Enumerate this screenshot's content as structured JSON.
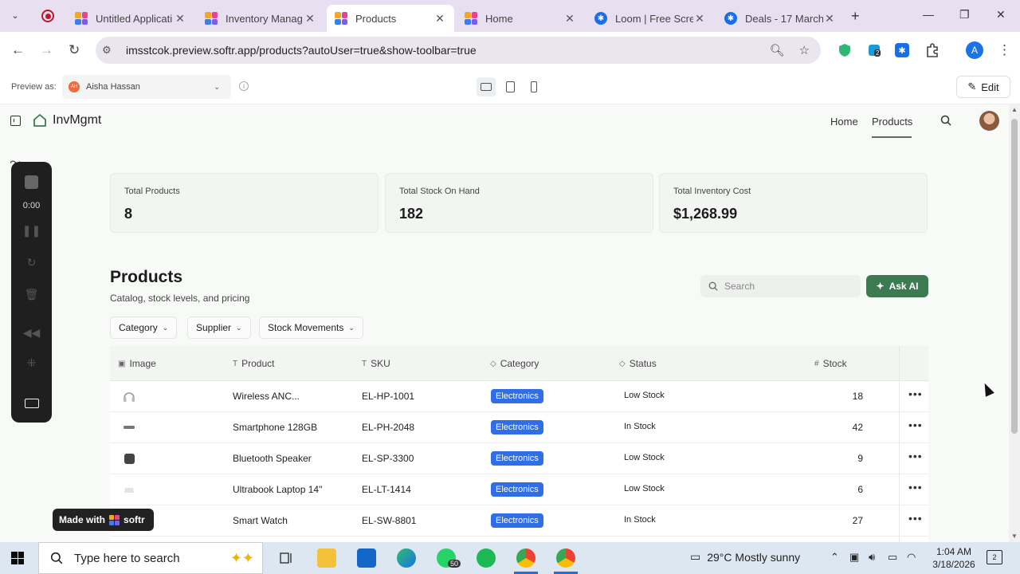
{
  "browser": {
    "tabs": [
      {
        "title": "Untitled Applicati",
        "favicon": "softr-icon"
      },
      {
        "title": "Inventory Manag",
        "favicon": "softr-icon"
      },
      {
        "title": "Products",
        "favicon": "softr-icon",
        "active": true
      },
      {
        "title": "Home",
        "favicon": "softr-icon"
      },
      {
        "title": "Loom | Free Scre",
        "favicon": "loom-icon"
      },
      {
        "title": "Deals - 17 March",
        "favicon": "loom-icon"
      }
    ],
    "url": "imsstcok.preview.softr.app/products?autoUser=true&show-toolbar=true",
    "extension_badge": "2",
    "profile_initial": "A"
  },
  "preview_bar": {
    "label": "Preview as:",
    "user_initials": "AH",
    "user_name": "Aisha Hassan",
    "edit_label": "Edit"
  },
  "app": {
    "logo_text": "InvMgmt",
    "nav": [
      {
        "label": "Home"
      },
      {
        "label": "Products",
        "active": true
      }
    ],
    "stats": [
      {
        "label": "Total Products",
        "value": "8"
      },
      {
        "label": "Total Stock On Hand",
        "value": "182"
      },
      {
        "label": "Total Inventory Cost",
        "value": "$1,268.99"
      }
    ],
    "section": {
      "title": "Products",
      "subtitle": "Catalog, stock levels, and pricing",
      "search_placeholder": "Search",
      "ask_ai_label": "Ask AI"
    },
    "filters": [
      {
        "label": "Category"
      },
      {
        "label": "Supplier"
      },
      {
        "label": "Stock Movements"
      }
    ],
    "table": {
      "headers": {
        "image": "Image",
        "product": "Product",
        "sku": "SKU",
        "category": "Category",
        "status": "Status",
        "stock": "Stock"
      },
      "rows": [
        {
          "product": "Wireless ANC...",
          "sku": "EL-HP-1001",
          "category": "Electronics",
          "status": "Low Stock",
          "stock": "18",
          "thumb": "headphones-icon"
        },
        {
          "product": "Smartphone 128GB",
          "sku": "EL-PH-2048",
          "category": "Electronics",
          "status": "In Stock",
          "stock": "42",
          "thumb": "phone-icon"
        },
        {
          "product": "Bluetooth Speaker",
          "sku": "EL-SP-3300",
          "category": "Electronics",
          "status": "Low Stock",
          "stock": "9",
          "thumb": "speaker-icon"
        },
        {
          "product": "Ultrabook Laptop 14\"",
          "sku": "EL-LT-1414",
          "category": "Electronics",
          "status": "Low Stock",
          "stock": "6",
          "thumb": "laptop-icon"
        },
        {
          "product": "Smart Watch",
          "sku": "EL-SW-8801",
          "category": "Electronics",
          "status": "In Stock",
          "stock": "27",
          "thumb": "watch-icon"
        }
      ]
    },
    "made_with": {
      "prefix": "Made with",
      "brand": "softr"
    }
  },
  "loom": {
    "timer": "0:00"
  },
  "taskbar": {
    "search_placeholder": "Type here to search",
    "whatsapp_badge": "50",
    "weather": "29°C  Mostly sunny",
    "time": "1:04 AM",
    "date": "3/18/2026",
    "notifications": "2"
  },
  "colors": {
    "accent_green": "#3c7a52",
    "pill_blue": "#2f6ee6",
    "tab_strip": "#e8e0f0"
  }
}
